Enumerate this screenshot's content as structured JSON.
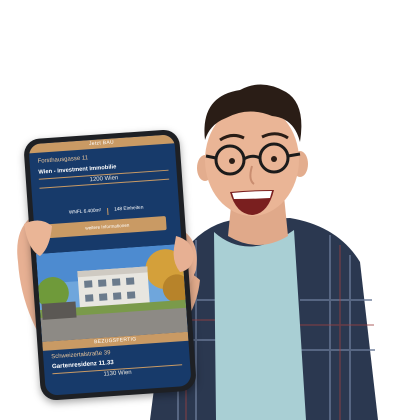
{
  "phone": {
    "status_bar": "Jetzt BAU",
    "top_listing": {
      "address": "Forsthausgasse 11",
      "title": "Wien - Investment Immobilie",
      "city": "1200 Wien",
      "area": "WNFL 6.400m²",
      "units": "148 Einheiten",
      "button": "weitere Informationen"
    },
    "sold_badge": "BEZUGSFERTIG",
    "bottom_listing": {
      "address": "Schweizertalstraße 39",
      "title": "Gartenresidenz 11.33",
      "city": "1130 Wien"
    }
  },
  "colors": {
    "navy": "#173a6a",
    "gold": "#c99a64",
    "shirt": "#a9cfd4",
    "plaid": "#2b3850"
  }
}
